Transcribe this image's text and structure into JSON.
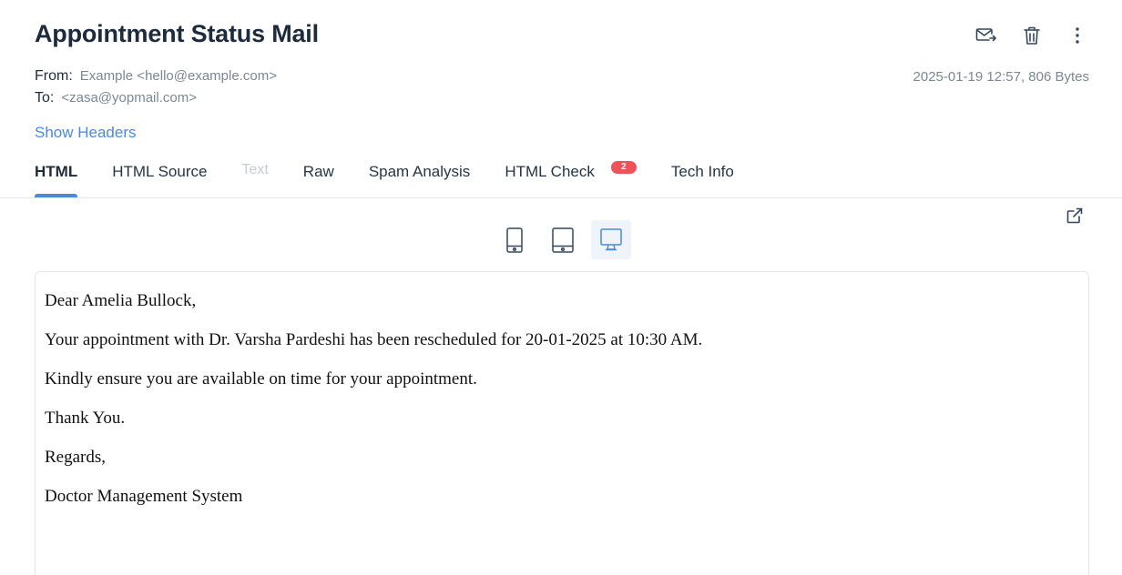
{
  "email": {
    "subject": "Appointment Status Mail",
    "from_label": "From:",
    "from_value": "Example <hello@example.com>",
    "to_label": "To:",
    "to_value": "<zasa@yopmail.com>",
    "info": "2025-01-19 12:57, 806 Bytes",
    "show_headers": "Show Headers"
  },
  "actions": {
    "forward_icon": "mail-forward-icon",
    "delete_icon": "trash-icon",
    "more_icon": "more-vertical-icon"
  },
  "tabs": [
    {
      "label": "HTML",
      "state": "active"
    },
    {
      "label": "HTML Source",
      "state": "normal"
    },
    {
      "label": "Text",
      "state": "disabled"
    },
    {
      "label": "Raw",
      "state": "normal"
    },
    {
      "label": "Spam Analysis",
      "state": "normal"
    },
    {
      "label": "HTML Check",
      "state": "normal",
      "badge": "2"
    },
    {
      "label": "Tech Info",
      "state": "normal"
    }
  ],
  "preview": {
    "devices": [
      {
        "icon": "mobile-icon",
        "selected": false
      },
      {
        "icon": "tablet-icon",
        "selected": false
      },
      {
        "icon": "desktop-icon",
        "selected": true
      }
    ],
    "body": [
      "Dear Amelia Bullock,",
      "Your appointment with Dr. Varsha Pardeshi has been rescheduled for 20-01-2025 at 10:30 AM.",
      "Kindly ensure you are available on time for your appointment.",
      "Thank You.",
      "Regards,",
      "Doctor Management System"
    ]
  },
  "colors": {
    "accent": "#4a8ad8",
    "badge": "#f0525a",
    "text_dark": "#1e2b3c",
    "text_muted": "#7b8794"
  }
}
